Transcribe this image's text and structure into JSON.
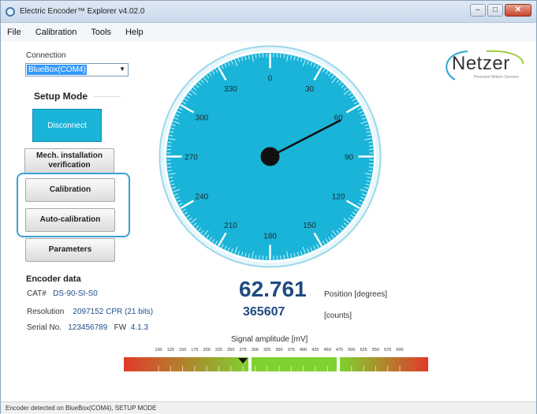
{
  "window": {
    "title": "Electric Encoder™ Explorer v4.02.0"
  },
  "menu": [
    "File",
    "Calibration",
    "Tools",
    "Help"
  ],
  "connection": {
    "label": "Connection",
    "value": "BlueBox(COM4)"
  },
  "setup_mode": {
    "title": "Setup Mode",
    "disconnect_label": "Disconnect"
  },
  "buttons": {
    "mech": "Mech. installation verification",
    "calibration": "Calibration",
    "auto_calibration": "Auto-calibration",
    "parameters": "Parameters"
  },
  "encoder_data": {
    "title": "Encoder data",
    "cat_label": "CAT#",
    "cat_value": "DS-90-SI-S0",
    "resolution_label": "Resolution",
    "resolution_value": "2097152 CPR (21 bits)",
    "serial_label": "Serial No.",
    "serial_value": "123456789",
    "fw_label": "FW",
    "fw_value": "4.1.3"
  },
  "logo": {
    "name": "Netzer",
    "tagline": "Precision Motion Sensors"
  },
  "gauge": {
    "labels": [
      "0",
      "30",
      "60",
      "90",
      "120",
      "150",
      "180",
      "210",
      "240",
      "270",
      "300",
      "330"
    ],
    "needle_deg": 62.761,
    "face_color": "#1ab4d8"
  },
  "position": {
    "value": "62.761",
    "unit": "Position [degrees]"
  },
  "counts": {
    "value": "365607",
    "unit": "[counts]"
  },
  "signal": {
    "label": "Signal amplitude [mV]",
    "ticks": [
      "100",
      "125",
      "150",
      "175",
      "200",
      "225",
      "250",
      "275",
      "300",
      "325",
      "350",
      "375",
      "400",
      "425",
      "450",
      "475",
      "500",
      "525",
      "550",
      "575",
      "600"
    ],
    "min": 100,
    "max": 600,
    "marker_value": 275
  },
  "status": "Encoder detected on BlueBox(COM4), SETUP MODE"
}
